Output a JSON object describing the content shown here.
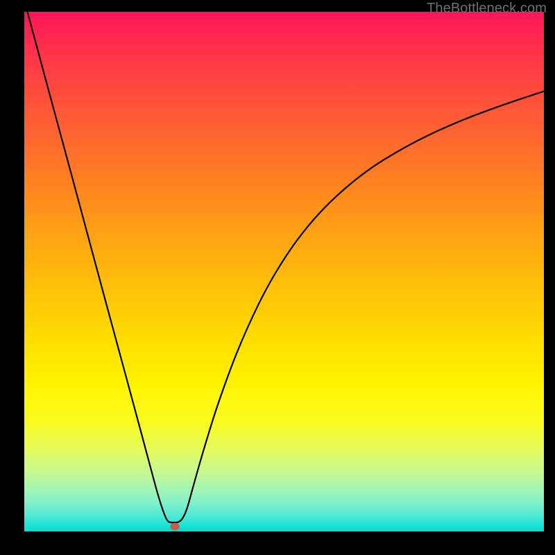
{
  "watermark": "TheBottleneck.com",
  "marker": {
    "x_frac": 0.2897,
    "y_frac": 0.99
  },
  "chart_data": {
    "type": "line",
    "title": "",
    "xlabel": "",
    "ylabel": "",
    "xlim": [
      0,
      1
    ],
    "ylim": [
      0,
      1
    ],
    "grid": false,
    "series": [
      {
        "name": "bottleneck-curve",
        "x": [
          0.006,
          0.03,
          0.06,
          0.09,
          0.12,
          0.15,
          0.18,
          0.21,
          0.24,
          0.258,
          0.27,
          0.276,
          0.282,
          0.3,
          0.312,
          0.324,
          0.345,
          0.375,
          0.42,
          0.48,
          0.555,
          0.645,
          0.735,
          0.825,
          0.915,
          1.0
        ],
        "y": [
          1.0,
          0.911,
          0.8,
          0.69,
          0.578,
          0.467,
          0.356,
          0.246,
          0.134,
          0.067,
          0.031,
          0.019,
          0.017,
          0.017,
          0.038,
          0.083,
          0.157,
          0.254,
          0.374,
          0.497,
          0.603,
          0.686,
          0.742,
          0.785,
          0.819,
          0.847
        ]
      }
    ],
    "annotations": [
      {
        "name": "minimum-marker",
        "x": 0.2897,
        "y": 0.01
      }
    ],
    "background_gradient": {
      "direction": "vertical",
      "stops": [
        {
          "pos": 0.0,
          "color": "#ff1658"
        },
        {
          "pos": 0.5,
          "color": "#ffc108"
        },
        {
          "pos": 0.75,
          "color": "#fff500"
        },
        {
          "pos": 1.0,
          "color": "#00dfcc"
        }
      ]
    }
  }
}
